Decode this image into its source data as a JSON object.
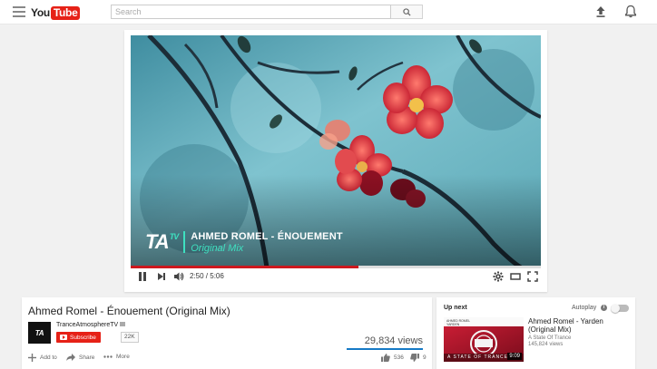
{
  "masthead": {
    "logo_you": "You",
    "logo_tube": "Tube",
    "search_placeholder": "Search"
  },
  "player": {
    "overlay_logo": "TA",
    "overlay_logo_sup": "TV",
    "overlay_artist": "AHMED ROMEL - ÉNOUEMENT",
    "overlay_mix": "Original Mix",
    "current_time": "2:50",
    "duration": "5:06",
    "time_display": "2:50 / 5:06",
    "progress_fraction": 0.555,
    "buffered_fraction": 0.555,
    "colors": {
      "accent": "#3ee0c0",
      "progress": "#cc181e"
    }
  },
  "video_info": {
    "title": "Ahmed Romel - Énouement (Original Mix)",
    "channel_name": "TranceAtmosphereTV",
    "avatar_text": "TA",
    "subscribe_label": "Subscribe",
    "subscriber_count": "22K",
    "views": "29,834 views",
    "actions": {
      "add_to": "Add to",
      "share": "Share",
      "more": "More"
    },
    "likes": "536",
    "dislikes": "9"
  },
  "up_next": {
    "label": "Up next",
    "autoplay_label": "Autoplay",
    "autoplay_on": false,
    "info_glyph": "i",
    "video": {
      "title": "Ahmed Romel - Yarden (Original Mix)",
      "channel": "A State Of Trance",
      "views": "145,824 views",
      "duration": "9:09",
      "thumb_top_label": "AHMED ROMEL\nYARDEN",
      "thumb_bottom_label": "A STATE OF TRANCE"
    }
  }
}
